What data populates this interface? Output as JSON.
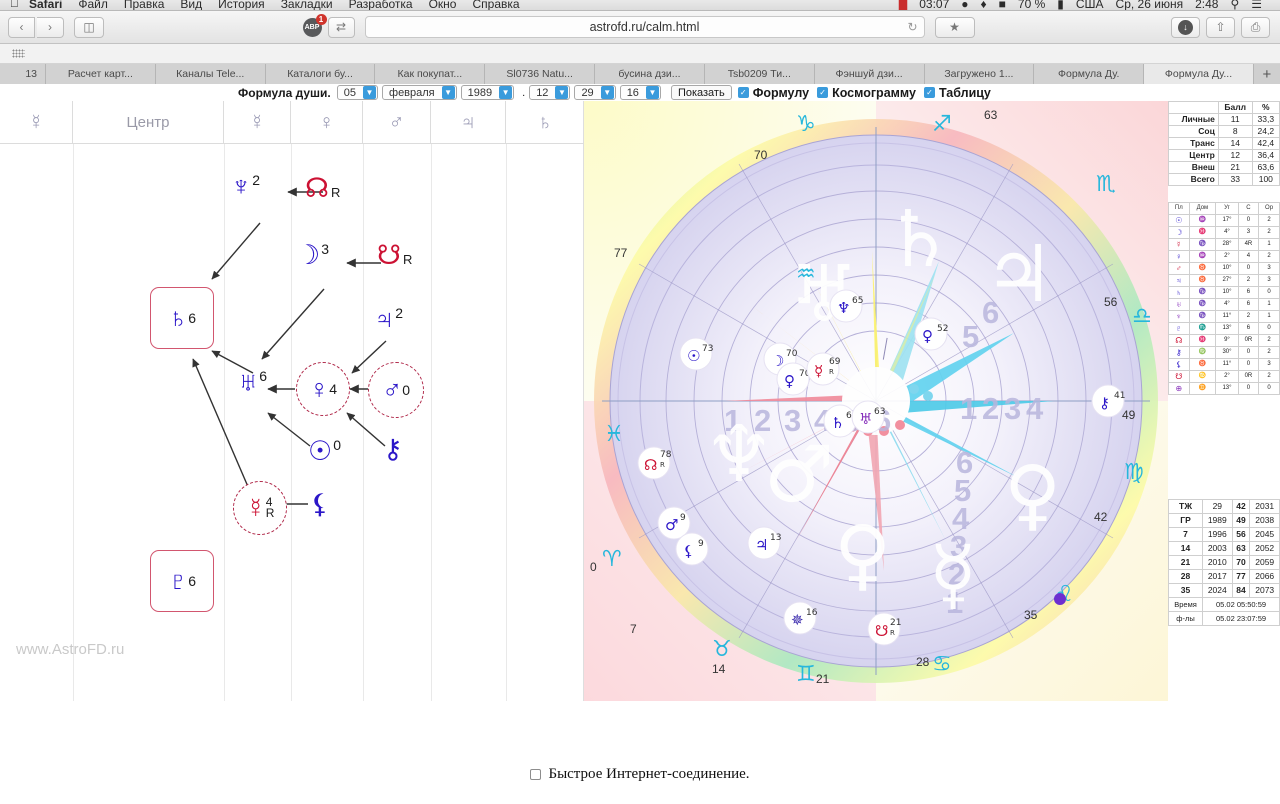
{
  "menubar": {
    "apple_icon": "apple-icon",
    "app_name": "Safari",
    "items": [
      "Файл",
      "Правка",
      "Вид",
      "История",
      "Закладки",
      "Разработка",
      "Окно",
      "Справка"
    ],
    "status_right": [
      "03:07",
      "70 %",
      "США",
      "Ср, 26 июня",
      "2:48"
    ],
    "icons": [
      "record-icon",
      "shield-icon",
      "dropbox-icon",
      "battery-icon",
      "flag-icon",
      "search-icon",
      "list-icon"
    ]
  },
  "toolbar": {
    "back_icon": "chevron-left-icon",
    "forward_icon": "chevron-right-icon",
    "sidebar_icon": "sidebar-icon",
    "adblock_label": "ABP",
    "adblock_count": "1",
    "share_arrows_icon": "swap-icon",
    "url": "astrofd.ru/calm.html",
    "reload_icon": "reload-icon",
    "reader_icon": "reader-icon",
    "download_icon": "download-icon",
    "share_icon": "share-icon",
    "tabs_icon": "tabs-icon"
  },
  "tabbar": {
    "index": "13",
    "tabs": [
      "Расчет карт...",
      "Каналы Tele...",
      "Каталоги бу...",
      "Как покупат...",
      "Sl0736 Natu...",
      "бусина дзи...",
      "Tsb0209 Ти...",
      "Фэншуй дзи...",
      "Загружено 1...",
      "Формула Ду.",
      "Формула Ду..."
    ],
    "active_index": 10,
    "new_tab_label": "+"
  },
  "form": {
    "title": "Формула души.",
    "day": "05",
    "month": "февраля",
    "year": "1989",
    "separator": ".",
    "hour": "12",
    "minute": "29",
    "zone": "16",
    "show_button": "Показать",
    "checkboxes": [
      {
        "label": "Формулу",
        "checked": true
      },
      {
        "label": "Космограмму",
        "checked": true
      },
      {
        "label": "Таблицу",
        "checked": true
      }
    ]
  },
  "formula": {
    "columns": [
      {
        "label": "☿",
        "type": "glyph"
      },
      {
        "label": "Центр",
        "type": "text"
      },
      {
        "label": "☿",
        "type": "glyph"
      },
      {
        "label": "♀",
        "type": "glyph"
      },
      {
        "label": "♂",
        "type": "glyph"
      },
      {
        "label": "♃",
        "type": "glyph"
      },
      {
        "label": "♄",
        "type": "glyph"
      }
    ],
    "nodes": [
      {
        "name": "neptune",
        "glyph": "♆",
        "sup": "2",
        "color": "#2b16c8",
        "style": "plain"
      },
      {
        "name": "north-node",
        "glyph": "☊",
        "sup": "",
        "retro": "R",
        "color": "#cc1133",
        "style": "plain"
      },
      {
        "name": "moon",
        "glyph": "☽",
        "sup": "3",
        "color": "#2b16c8",
        "style": "plain"
      },
      {
        "name": "south-node",
        "glyph": "☋",
        "sup": "",
        "retro": "R",
        "color": "#cc1133",
        "style": "plain"
      },
      {
        "name": "jupiter",
        "glyph": "♃",
        "sup": "2",
        "color": "#2b16c8",
        "style": "plain"
      },
      {
        "name": "saturn",
        "glyph": "♄",
        "sup": "6",
        "color": "#2b16c8",
        "style": "boxed"
      },
      {
        "name": "uranus",
        "glyph": "♅",
        "sup": "6",
        "color": "#2b16c8",
        "style": "plain"
      },
      {
        "name": "venus",
        "glyph": "♀",
        "sup": "4",
        "color": "#2b16c8",
        "style": "dashed"
      },
      {
        "name": "mars",
        "glyph": "♂",
        "sup": "0",
        "color": "#2b16c8",
        "style": "dashed"
      },
      {
        "name": "sun",
        "glyph": "☉",
        "sup": "0",
        "color": "#2b16c8",
        "style": "plain"
      },
      {
        "name": "chiron",
        "glyph": "⚷",
        "sup": "",
        "color": "#2b16c8",
        "style": "plain"
      },
      {
        "name": "mercury",
        "glyph": "☿",
        "sup": "4",
        "retro": "R",
        "color": "#cc1133",
        "style": "dashed"
      },
      {
        "name": "lilith",
        "glyph": "⚸",
        "sup": "",
        "color": "#2b16c8",
        "style": "plain"
      },
      {
        "name": "pluto",
        "glyph": "♇",
        "sup": "6",
        "color": "#2b16c8",
        "style": "boxed"
      }
    ],
    "watermark": "www.AstroFD.ru"
  },
  "chart_data": {
    "type": "scatter",
    "title": "Космограмма",
    "zodiac_glyphs": [
      "♈",
      "♉",
      "♊",
      "♋",
      "♌",
      "♍",
      "♎",
      "♏",
      "♐",
      "♑",
      "♒",
      "♓"
    ],
    "outer_tick_labels": [
      "0",
      "7",
      "14",
      "21",
      "28",
      "35",
      "42",
      "49",
      "56",
      "63",
      "70",
      "77"
    ],
    "house_numbers": [
      "1",
      "2",
      "3",
      "4",
      "5",
      "6"
    ],
    "planets": [
      {
        "name": "sun",
        "glyph": "☉",
        "value": "73",
        "angle": 117,
        "radius": 0.8
      },
      {
        "name": "north-node",
        "glyph": "☊",
        "value": "78",
        "retro": "R",
        "angle": 144,
        "radius": 0.81
      },
      {
        "name": "neptune",
        "glyph": "♆",
        "value": "65",
        "angle": 57,
        "radius": 0.7
      },
      {
        "name": "moon",
        "glyph": "☽",
        "value": "70",
        "angle": 81,
        "radius": 0.52
      },
      {
        "name": "venus",
        "glyph": "♀",
        "value": "70",
        "angle": 96,
        "radius": 0.45
      },
      {
        "name": "mercury",
        "glyph": "☿",
        "value": "69",
        "retro": "R",
        "angle": 74,
        "radius": 0.49
      },
      {
        "name": "saturn",
        "glyph": "♄",
        "value": "6",
        "angle": 40,
        "radius": 0.62
      },
      {
        "name": "uranus",
        "glyph": "♅",
        "value": "63",
        "angle": 33,
        "radius": 0.66
      },
      {
        "name": "pallas",
        "glyph": "♀",
        "value": "52",
        "angle": 20,
        "radius": 0.6
      },
      {
        "name": "chiron",
        "glyph": "⚷",
        "value": "41",
        "angle": -1,
        "radius": 0.7
      },
      {
        "name": "mars",
        "glyph": "♂",
        "value": "9",
        "angle": 211,
        "radius": 0.63
      },
      {
        "name": "lilith",
        "glyph": "⚸",
        "value": "9",
        "angle": 217,
        "radius": 0.6
      },
      {
        "name": "jupiter",
        "glyph": "♃",
        "value": "13",
        "angle": 232,
        "radius": 0.48
      },
      {
        "name": "pluto",
        "glyph": "✵",
        "value": "16",
        "angle": 264,
        "radius": 0.6
      },
      {
        "name": "south-node",
        "glyph": "☋",
        "value": "21",
        "retro": "R",
        "angle": 285,
        "radius": 0.66
      }
    ],
    "notes": "Radial astrological wheel (cosmogram) with colored aspect rays in center"
  },
  "score_table": {
    "headers": [
      "",
      "Балл",
      "%"
    ],
    "rows": [
      [
        "Личные",
        "11",
        "33,3"
      ],
      [
        "Соц",
        "8",
        "24,2"
      ],
      [
        "Транс",
        "14",
        "42,4"
      ],
      [
        "Центр",
        "12",
        "36,4"
      ],
      [
        "Внеш",
        "21",
        "63,6"
      ],
      [
        "Всего",
        "33",
        "100"
      ]
    ]
  },
  "planet_table": {
    "headers": [
      "Пл",
      "Дом",
      "Уг",
      "С",
      "Ор"
    ],
    "rows": [
      {
        "planet": "☉",
        "color": "#2b16c8",
        "house": "♒",
        "angle": "17°",
        "c": "0",
        "or": "2"
      },
      {
        "planet": "☽",
        "color": "#2b16c8",
        "house": "♓",
        "angle": "4°",
        "c": "3",
        "or": "2"
      },
      {
        "planet": "☿",
        "color": "#cc1133",
        "house": "♑",
        "angle": "28°",
        "c": "4R",
        "or": "1"
      },
      {
        "planet": "♀",
        "color": "#2b16c8",
        "house": "♒",
        "angle": "2°",
        "c": "4",
        "or": "2"
      },
      {
        "planet": "♂",
        "color": "#cc1133",
        "house": "♉",
        "angle": "10°",
        "c": "0",
        "or": "3"
      },
      {
        "planet": "♃",
        "color": "#2b16c8",
        "house": "♉",
        "angle": "27°",
        "c": "2",
        "or": "3"
      },
      {
        "planet": "♄",
        "color": "#2b16c8",
        "house": "♑",
        "angle": "10°",
        "c": "6",
        "or": "0"
      },
      {
        "planet": "♅",
        "color": "#8833bb",
        "house": "♑",
        "angle": "4°",
        "c": "6",
        "or": "1"
      },
      {
        "planet": "♆",
        "color": "#8833bb",
        "house": "♑",
        "angle": "11°",
        "c": "2",
        "or": "1"
      },
      {
        "planet": "♇",
        "color": "#2b16c8",
        "house": "♏",
        "angle": "13°",
        "c": "6",
        "or": "0"
      },
      {
        "planet": "☊",
        "color": "#cc1133",
        "house": "♓",
        "angle": "9°",
        "c": "0R",
        "or": "2"
      },
      {
        "planet": "⚷",
        "color": "#2b16c8",
        "house": "♍",
        "angle": "30°",
        "c": "0",
        "or": "2"
      },
      {
        "planet": "⚸",
        "color": "#2b16c8",
        "house": "♉",
        "angle": "11°",
        "c": "0",
        "or": "3"
      },
      {
        "planet": "☋",
        "color": "#cc1133",
        "house": "♋",
        "angle": "2°",
        "c": "0R",
        "or": "2"
      },
      {
        "planet": "⊕",
        "color": "#8833bb",
        "house": "♊",
        "angle": "13°",
        "c": "0",
        "or": "0"
      }
    ]
  },
  "year_table": {
    "rows": [
      [
        "ТЖ",
        "29",
        "42",
        "2031"
      ],
      [
        "ГР",
        "1989",
        "49",
        "2038"
      ],
      [
        "7",
        "1996",
        "56",
        "2045"
      ],
      [
        "14",
        "2003",
        "63",
        "2052"
      ],
      [
        "21",
        "2010",
        "70",
        "2059"
      ],
      [
        "28",
        "2017",
        "77",
        "2066"
      ],
      [
        "35",
        "2024",
        "84",
        "2073"
      ]
    ],
    "time_rows": [
      [
        "Время",
        "05.02 05:50:59"
      ],
      [
        "ф-лы",
        "05.02 23:07:59"
      ]
    ]
  },
  "bottom": {
    "fast_internet_label": "Быстрое Интернет-соединение.",
    "checked": false
  }
}
